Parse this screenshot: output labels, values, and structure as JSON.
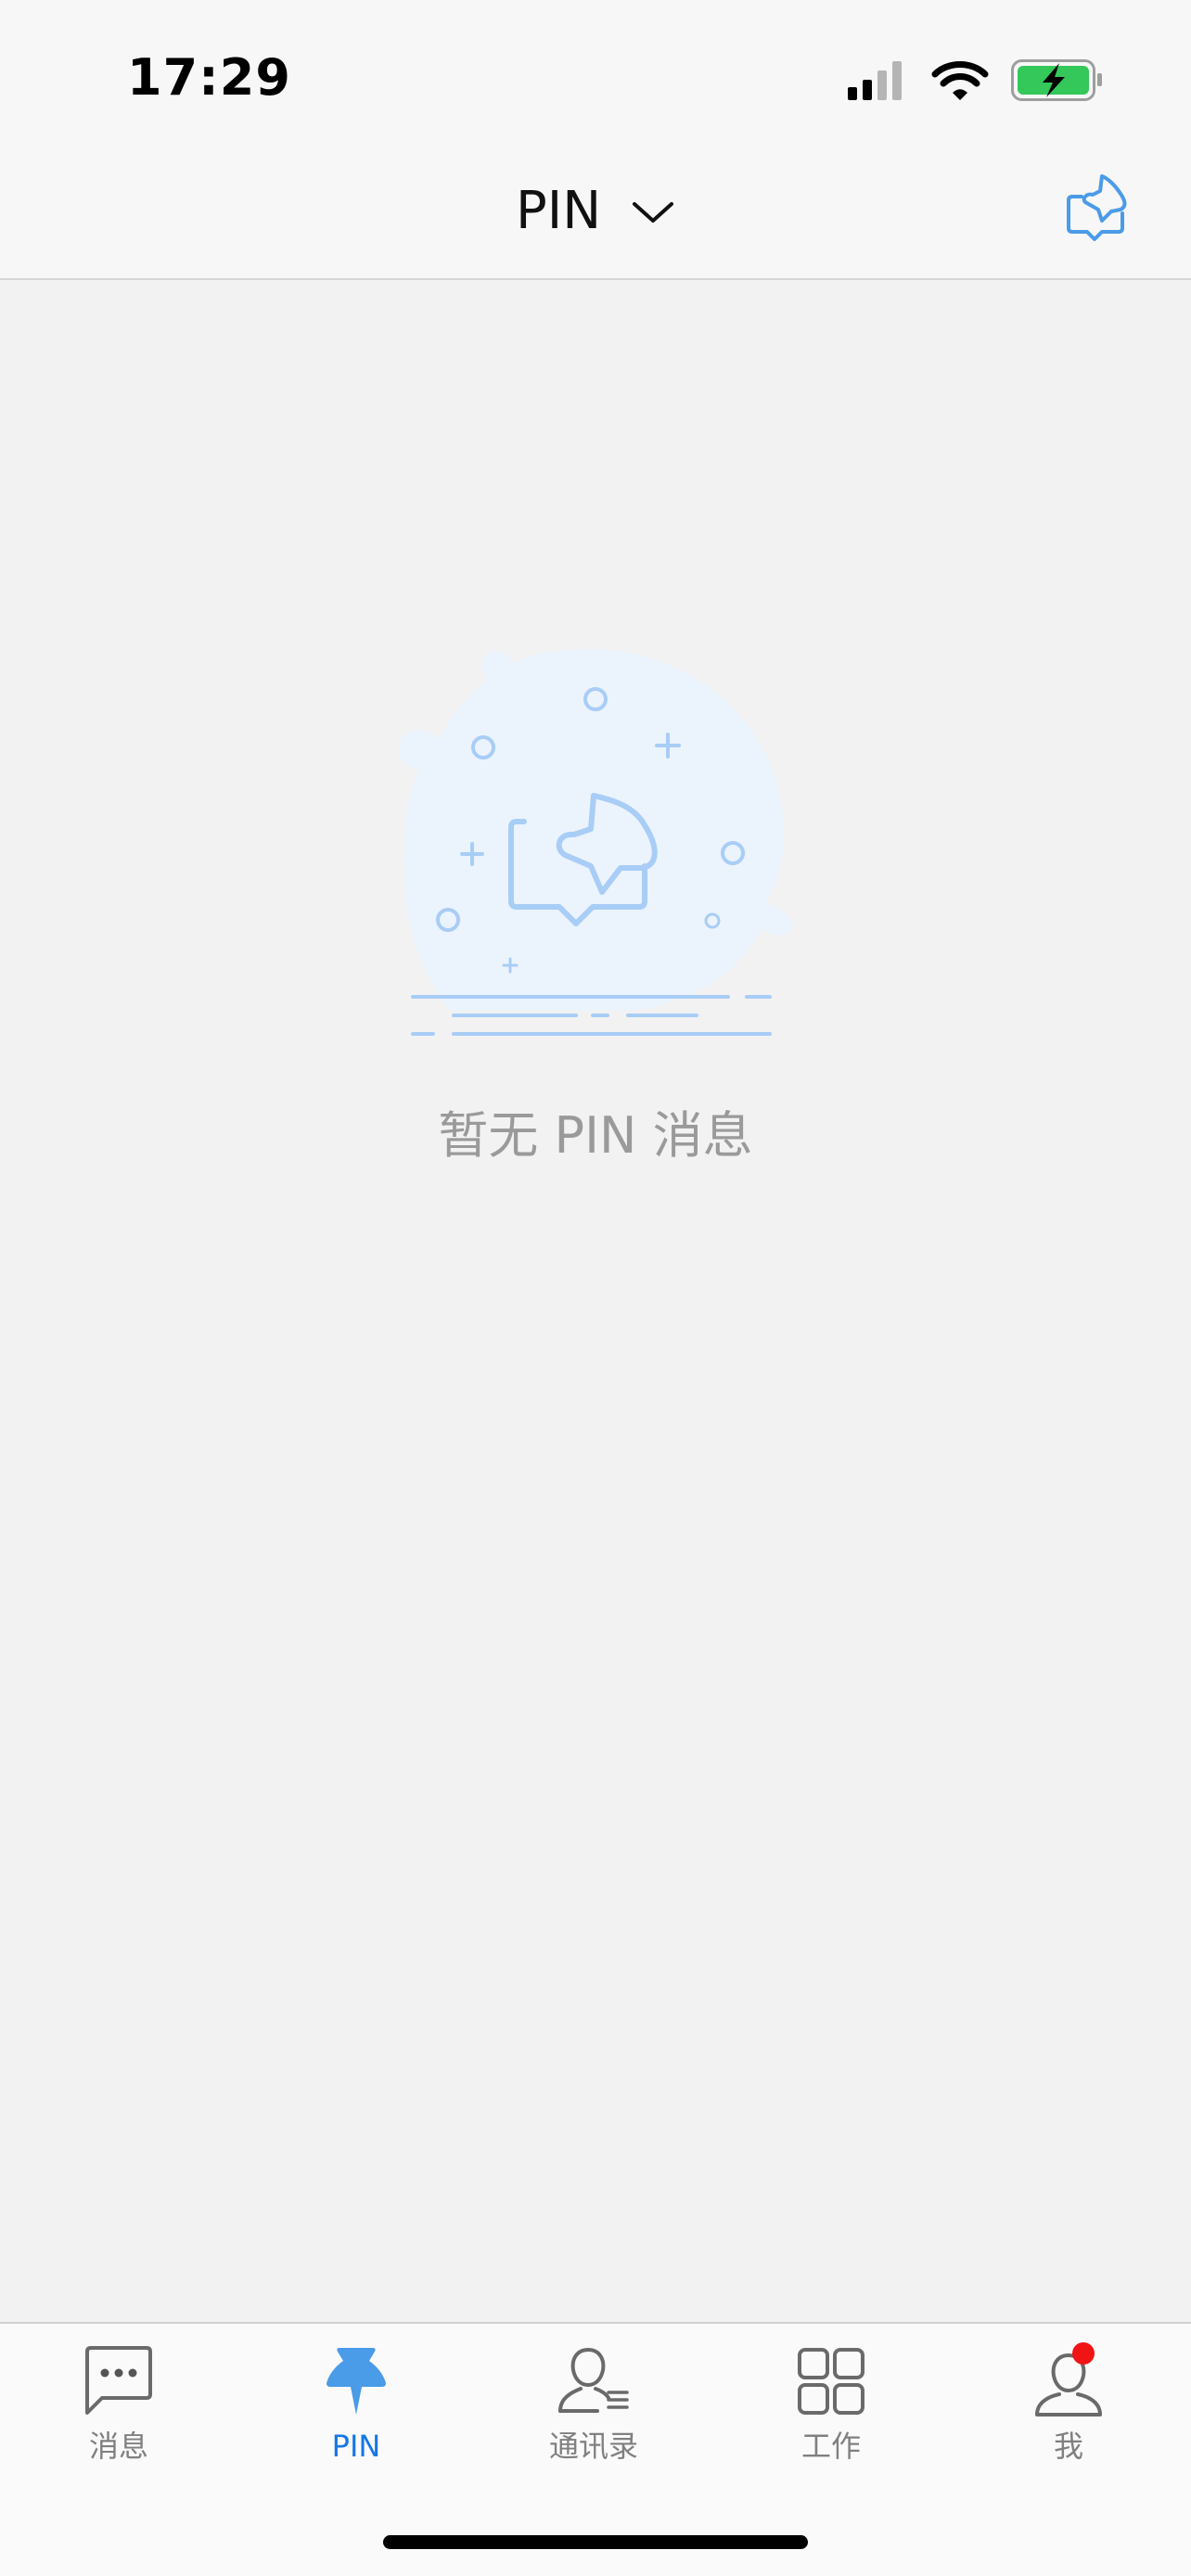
{
  "status_bar": {
    "time": "17:29",
    "icons": [
      "signal-icon",
      "wifi-icon",
      "battery-charging-icon"
    ]
  },
  "nav": {
    "title": "PIN",
    "dropdown_icon": "chevron-down-icon",
    "action_icon": "pin-message-icon"
  },
  "empty_state": {
    "message": "暂无 PIN 消息",
    "illustration": "empty-pin-illustration"
  },
  "tabbar": {
    "tabs": [
      {
        "label": "消息",
        "icon": "chat-bubble-icon",
        "active": false
      },
      {
        "label": "PIN",
        "icon": "pushpin-icon",
        "active": true
      },
      {
        "label": "通讯录",
        "icon": "contacts-icon",
        "active": false
      },
      {
        "label": "工作",
        "icon": "grid-apps-icon",
        "active": false
      },
      {
        "label": "我",
        "icon": "profile-icon",
        "active": false,
        "badge": true
      }
    ]
  },
  "colors": {
    "accent": "#1677e6",
    "icon_blue": "#4a9be8",
    "badge_red": "#f01414",
    "battery_green": "#34c759"
  }
}
